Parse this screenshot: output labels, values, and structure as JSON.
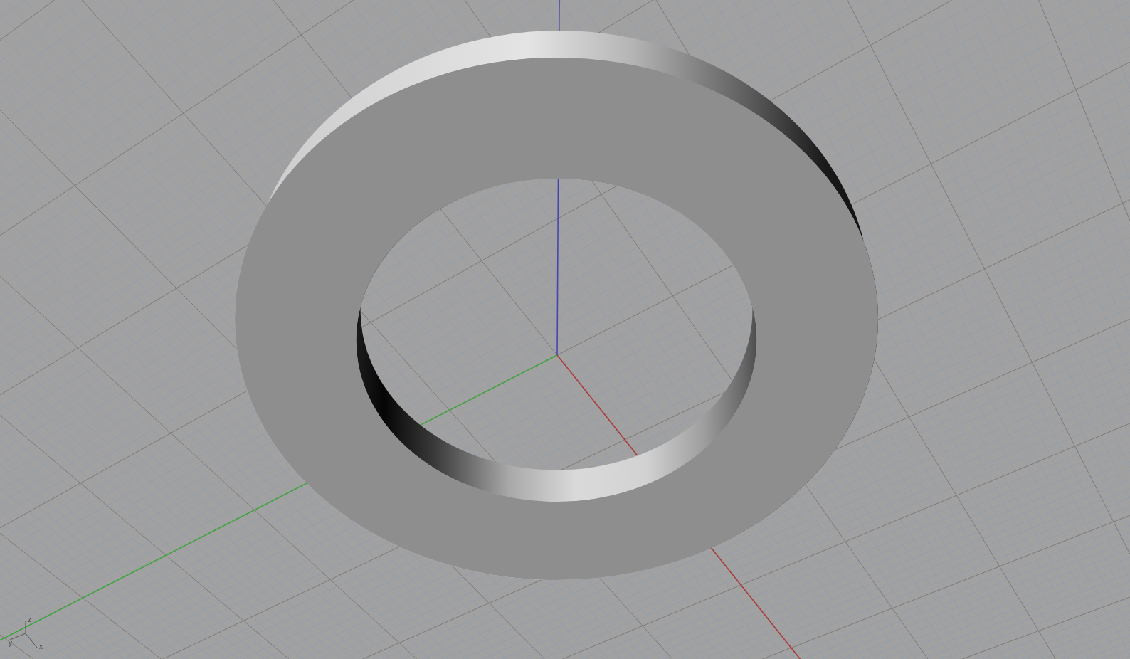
{
  "viewport": {
    "axis_triad": {
      "labels": [
        "z",
        "y",
        "x"
      ]
    }
  }
}
